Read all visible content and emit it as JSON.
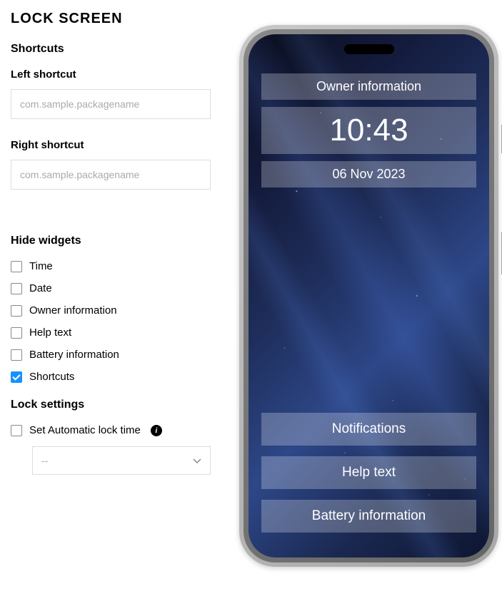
{
  "title": "LOCK SCREEN",
  "shortcuts": {
    "heading": "Shortcuts",
    "left": {
      "label": "Left shortcut",
      "placeholder": "com.sample.packagename",
      "value": ""
    },
    "right": {
      "label": "Right shortcut",
      "placeholder": "com.sample.packagename",
      "value": ""
    }
  },
  "hideWidgets": {
    "heading": "Hide widgets",
    "items": [
      {
        "label": "Time",
        "checked": false
      },
      {
        "label": "Date",
        "checked": false
      },
      {
        "label": "Owner information",
        "checked": false
      },
      {
        "label": "Help text",
        "checked": false
      },
      {
        "label": "Battery information",
        "checked": false
      },
      {
        "label": "Shortcuts",
        "checked": true
      }
    ]
  },
  "lockSettings": {
    "heading": "Lock settings",
    "autoLock": {
      "label": "Set Automatic lock time",
      "checked": false
    },
    "select": {
      "value": "--"
    }
  },
  "preview": {
    "ownerInfo": "Owner information",
    "time": "10:43",
    "date": "06 Nov 2023",
    "notifications": "Notifications",
    "helpText": "Help text",
    "batteryInfo": "Battery information"
  }
}
